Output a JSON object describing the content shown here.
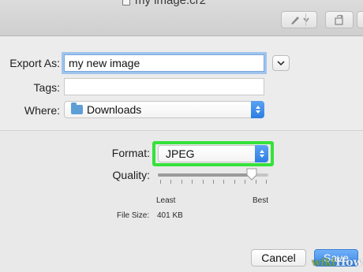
{
  "window": {
    "document_title": "my image.cr2"
  },
  "toolbar": {
    "pen_icon": "pen-icon",
    "pen_menu_icon": "chevron-down-icon",
    "rotate_icon": "rotate-icon"
  },
  "export_sheet": {
    "export_as_label": "Export As:",
    "export_as_value": "my new image",
    "tags_label": "Tags:",
    "tags_value": "",
    "where_label": "Where:",
    "where_value": "Downloads",
    "where_icon": "folder-icon",
    "expand_icon": "chevron-down-icon"
  },
  "options": {
    "format_label": "Format:",
    "format_value": "JPEG",
    "quality_label": "Quality:",
    "quality_min_label": "Least",
    "quality_max_label": "Best",
    "quality_level_fraction": 0.85,
    "file_size_label": "File Size:",
    "file_size_value": "401 KB"
  },
  "buttons": {
    "cancel_label": "Cancel",
    "save_label": "Save"
  },
  "colors": {
    "highlight": "#35e23a",
    "accent_blue": "#3b87e8"
  },
  "watermark": {
    "wiki": "wiki",
    "how": "How"
  }
}
